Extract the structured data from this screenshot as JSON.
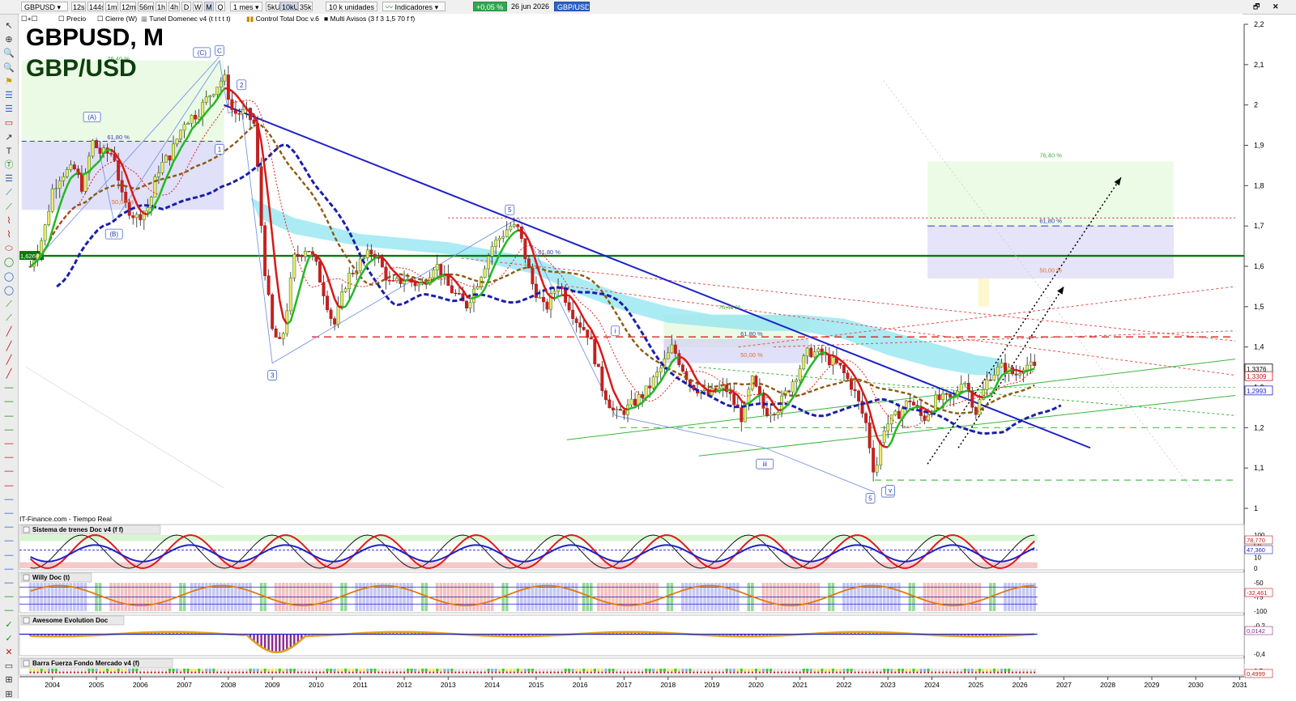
{
  "toolbar": {
    "symbol": "GBPUSD",
    "timeframes": [
      "12s",
      "144s",
      "1m",
      "12m",
      "56m",
      "1h",
      "4h",
      "D",
      "W",
      "M",
      "Q"
    ],
    "active_timeframe": "M",
    "period": "1 mes",
    "volume_modes": [
      "5kU",
      "10kU",
      "35kU"
    ],
    "active_volume_mode": "10kU",
    "units": "10 k unidades",
    "indicators_label": "Indicadores",
    "change_badge": "+0,05 %",
    "date": "26 jun 2026",
    "instrument_badge": "GBP/USD"
  },
  "legend": {
    "items": [
      "Precio",
      "Cierre (W)",
      "Tunel Domenec v4 (t t t t t)",
      "Control Total Doc v.6",
      "Multi Avisos (3 f 3 1,5 70 f f)"
    ]
  },
  "title": {
    "symbol_period": "GBPUSD, M",
    "name": "GBP/USD"
  },
  "source_label": "IT-Finance.com - Tiempo Real",
  "colors": {
    "up": "#2a7a2a",
    "down": "#b01818",
    "trendline": "#1e22c8",
    "support": "#0b7a0b",
    "cloud": "#8fe4f0",
    "bg_panel": "#ffffff"
  },
  "chart_data": [
    {
      "type": "candlestick",
      "title": "GBPUSD, M",
      "subtitle": "GBP/USD",
      "x_axis": {
        "type": "year",
        "ticks": [
          "2004",
          "2005",
          "2006",
          "2007",
          "2008",
          "2009",
          "2010",
          "2011",
          "2012",
          "2013",
          "2014",
          "2015",
          "2016",
          "2017",
          "2018",
          "2019",
          "2020",
          "2021",
          "2022",
          "2023",
          "2024",
          "2025",
          "2026",
          "2027",
          "2028",
          "2029",
          "2030",
          "2031"
        ]
      },
      "y_axis": {
        "position": "right",
        "range": [
          1.0,
          2.2
        ],
        "ticks": [
          "1",
          "1,1",
          "1,2",
          "1,3",
          "1,4",
          "1,5",
          "1,6",
          "1,7",
          "1,8",
          "1,9",
          "2",
          "2,1",
          "2,2"
        ]
      },
      "price_labels": [
        "1,3376",
        "1,3309",
        "1,2993"
      ],
      "left_price_label": "1,62600",
      "horizontal_level": 1.626,
      "close_series": [
        {
          "t": 2003.5,
          "v": 1.6
        },
        {
          "t": 2003.8,
          "v": 1.68
        },
        {
          "t": 2004.0,
          "v": 1.79
        },
        {
          "t": 2004.2,
          "v": 1.83
        },
        {
          "t": 2004.5,
          "v": 1.84
        },
        {
          "t": 2004.7,
          "v": 1.79
        },
        {
          "t": 2004.9,
          "v": 1.91
        },
        {
          "t": 2005.1,
          "v": 1.88
        },
        {
          "t": 2005.4,
          "v": 1.88
        },
        {
          "t": 2005.6,
          "v": 1.76
        },
        {
          "t": 2005.9,
          "v": 1.72
        },
        {
          "t": 2006.2,
          "v": 1.75
        },
        {
          "t": 2006.4,
          "v": 1.84
        },
        {
          "t": 2006.7,
          "v": 1.88
        },
        {
          "t": 2007.0,
          "v": 1.96
        },
        {
          "t": 2007.3,
          "v": 1.98
        },
        {
          "t": 2007.6,
          "v": 2.03
        },
        {
          "t": 2007.9,
          "v": 2.07
        },
        {
          "t": 2008.1,
          "v": 1.98
        },
        {
          "t": 2008.4,
          "v": 1.98
        },
        {
          "t": 2008.6,
          "v": 1.95
        },
        {
          "t": 2008.8,
          "v": 1.62
        },
        {
          "t": 2009.0,
          "v": 1.44
        },
        {
          "t": 2009.2,
          "v": 1.4
        },
        {
          "t": 2009.5,
          "v": 1.62
        },
        {
          "t": 2009.8,
          "v": 1.65
        },
        {
          "t": 2010.0,
          "v": 1.6
        },
        {
          "t": 2010.4,
          "v": 1.45
        },
        {
          "t": 2010.7,
          "v": 1.57
        },
        {
          "t": 2011.0,
          "v": 1.61
        },
        {
          "t": 2011.3,
          "v": 1.64
        },
        {
          "t": 2011.7,
          "v": 1.55
        },
        {
          "t": 2012.0,
          "v": 1.57
        },
        {
          "t": 2012.4,
          "v": 1.55
        },
        {
          "t": 2012.7,
          "v": 1.61
        },
        {
          "t": 2013.0,
          "v": 1.55
        },
        {
          "t": 2013.4,
          "v": 1.5
        },
        {
          "t": 2013.7,
          "v": 1.57
        },
        {
          "t": 2014.0,
          "v": 1.65
        },
        {
          "t": 2014.4,
          "v": 1.7
        },
        {
          "t": 2014.6,
          "v": 1.69
        },
        {
          "t": 2014.9,
          "v": 1.56
        },
        {
          "t": 2015.2,
          "v": 1.49
        },
        {
          "t": 2015.5,
          "v": 1.56
        },
        {
          "t": 2015.9,
          "v": 1.47
        },
        {
          "t": 2016.2,
          "v": 1.43
        },
        {
          "t": 2016.5,
          "v": 1.3
        },
        {
          "t": 2016.8,
          "v": 1.23
        },
        {
          "t": 2017.1,
          "v": 1.25
        },
        {
          "t": 2017.5,
          "v": 1.29
        },
        {
          "t": 2017.8,
          "v": 1.34
        },
        {
          "t": 2018.1,
          "v": 1.4
        },
        {
          "t": 2018.5,
          "v": 1.31
        },
        {
          "t": 2018.9,
          "v": 1.28
        },
        {
          "t": 2019.3,
          "v": 1.3
        },
        {
          "t": 2019.7,
          "v": 1.22
        },
        {
          "t": 2019.9,
          "v": 1.32
        },
        {
          "t": 2020.2,
          "v": 1.24
        },
        {
          "t": 2020.5,
          "v": 1.25
        },
        {
          "t": 2020.9,
          "v": 1.33
        },
        {
          "t": 2021.2,
          "v": 1.39
        },
        {
          "t": 2021.5,
          "v": 1.38
        },
        {
          "t": 2021.9,
          "v": 1.35
        },
        {
          "t": 2022.2,
          "v": 1.3
        },
        {
          "t": 2022.5,
          "v": 1.21
        },
        {
          "t": 2022.7,
          "v": 1.08
        },
        {
          "t": 2022.9,
          "v": 1.2
        },
        {
          "t": 2023.2,
          "v": 1.23
        },
        {
          "t": 2023.5,
          "v": 1.27
        },
        {
          "t": 2023.8,
          "v": 1.22
        },
        {
          "t": 2024.1,
          "v": 1.27
        },
        {
          "t": 2024.5,
          "v": 1.27
        },
        {
          "t": 2024.7,
          "v": 1.33
        },
        {
          "t": 2025.0,
          "v": 1.24
        },
        {
          "t": 2025.3,
          "v": 1.33
        },
        {
          "t": 2025.6,
          "v": 1.35
        },
        {
          "t": 2025.9,
          "v": 1.33
        },
        {
          "t": 2026.1,
          "v": 1.36
        },
        {
          "t": 2026.4,
          "v": 1.34
        }
      ],
      "annotations": {
        "wave_labels": [
          "(A)",
          "(B)",
          "(C)",
          "C",
          "1",
          "2",
          "3",
          "5",
          "i",
          "iii",
          "iv",
          "v",
          "5"
        ],
        "fibonacci": [
          "76,40 %",
          "61,80 %",
          "50,00 %",
          "76,40 %",
          "61,80 %",
          "50,00 %",
          "76,40 %",
          "61,80 %",
          "50,00 %",
          "61,80 %"
        ]
      }
    },
    {
      "type": "line",
      "title": "Sistema de trenes Doc v4 (f f)",
      "y_ticks": [
        "100",
        "50",
        "10",
        "0"
      ],
      "value_labels": [
        "78,770",
        "47,360"
      ]
    },
    {
      "type": "line",
      "title": "Willy Doc (t)",
      "y_ticks": [
        "-50",
        "-75",
        "-100"
      ],
      "value_labels": [
        "-32,461"
      ]
    },
    {
      "type": "bar",
      "title": "Awesome Evolution Doc",
      "y_ticks": [
        "-0,2",
        "-0,4"
      ],
      "value_labels": [
        "0,0142"
      ]
    },
    {
      "type": "bar",
      "title": "Barra Fuerza Fondo Mercado v4 (f)",
      "y_ticks": [
        "0,5"
      ],
      "value_labels": [
        "0,4999"
      ]
    }
  ]
}
